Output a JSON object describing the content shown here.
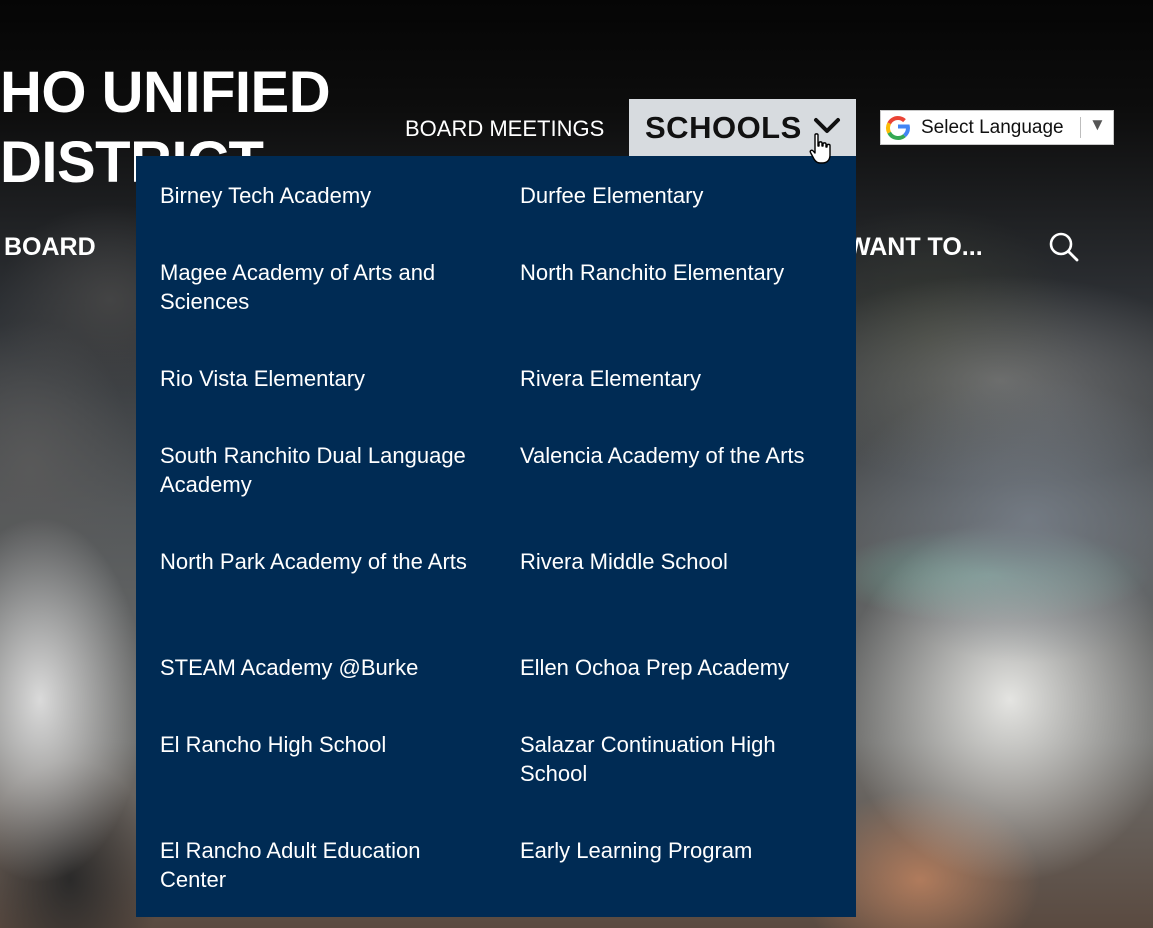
{
  "header": {
    "brand_line1": "HO UNIFIED",
    "brand_line2": "DISTRICT",
    "nav_board_meetings": "BOARD MEETINGS",
    "nav_schools": "SCHOOLS",
    "nav_board": "BOARD",
    "nav_want_to": "WANT TO...",
    "translate_label": "Select Language",
    "translate_arrow": "▼"
  },
  "dropdown": {
    "schools_left": [
      "Birney Tech Academy",
      "Magee Academy of Arts and Sciences",
      "Rio Vista Elementary",
      "South Ranchito Dual Language Academy",
      "North Park Academy of the Arts",
      "STEAM Academy @Burke",
      "El Rancho High School",
      "El Rancho Adult Education Center"
    ],
    "schools_right": [
      "Durfee Elementary",
      "North Ranchito Elementary",
      "Rivera Elementary",
      "Valencia Academy of the Arts",
      "Rivera Middle School",
      "Ellen Ochoa Prep Academy",
      "Salazar Continuation High School",
      "Early Learning Program"
    ]
  },
  "icons": {
    "chevron": "chevron-down-icon",
    "search": "search-icon",
    "google": "google-logo-icon",
    "cursor": "hand-cursor-icon"
  },
  "colors": {
    "dropdown_bg": "#002b54",
    "active_tab_bg": "#d7dbdf",
    "text_light": "#ffffff"
  }
}
